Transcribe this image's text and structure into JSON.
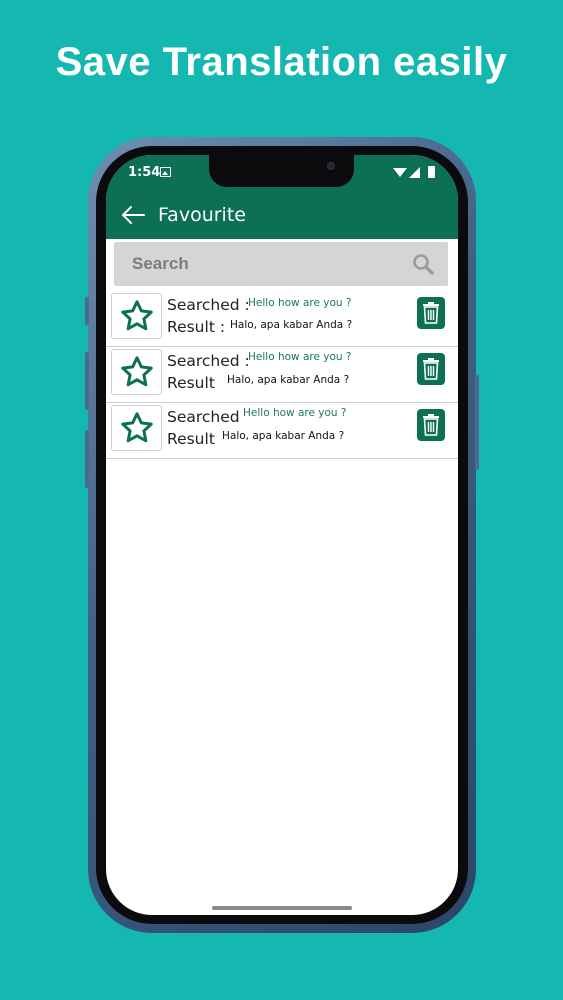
{
  "headline": "Save Translation easily",
  "status_bar": {
    "time": "1:54"
  },
  "app_bar": {
    "title": "Favourite"
  },
  "search": {
    "placeholder": "Search"
  },
  "favourites": [
    {
      "searched_label": "Searched :",
      "searched_text": "Hello how are you ?",
      "result_label": "Result :",
      "result_text": "Halo, apa kabar Anda ?"
    },
    {
      "searched_label": "Searched :",
      "searched_text": "Hello how are you ?",
      "result_label": "Result",
      "result_text": "Halo, apa kabar Anda ?"
    },
    {
      "searched_label": "Searched",
      "searched_text": "Hello how are you ?",
      "result_label": "Result",
      "result_text": "Halo, apa kabar Anda ?"
    }
  ],
  "colors": {
    "background": "#14b8b0",
    "primary": "#0d7052",
    "accent_text": "#1c7a55"
  },
  "icons": [
    "back-arrow-icon",
    "search-icon",
    "star-outline-icon",
    "trash-icon",
    "wifi-icon",
    "signal-icon",
    "battery-icon",
    "image-icon"
  ]
}
